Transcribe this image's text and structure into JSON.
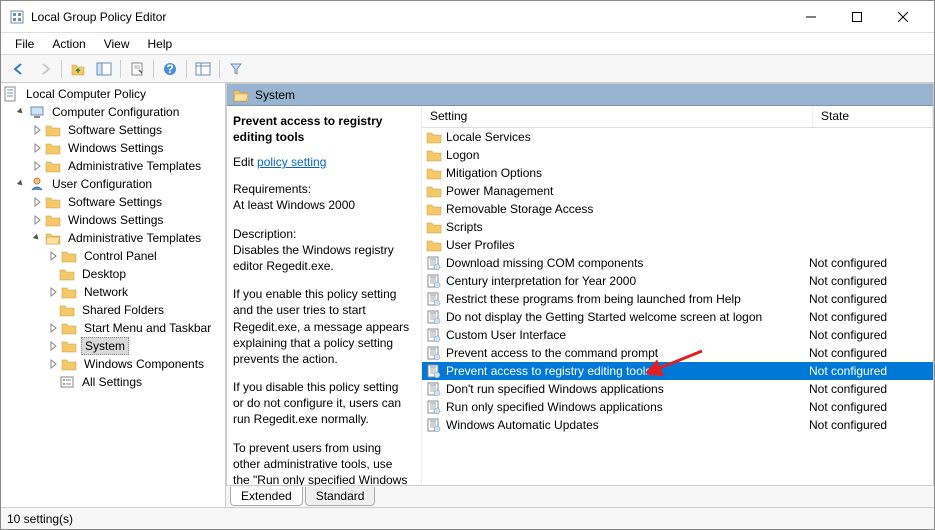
{
  "window": {
    "title": "Local Group Policy Editor"
  },
  "menus": [
    "File",
    "Action",
    "View",
    "Help"
  ],
  "tree": {
    "root": "Local Computer Policy",
    "comp_config": "Computer Configuration",
    "user_config": "User Configuration",
    "software": "Software Settings",
    "windows": "Windows Settings",
    "admin": "Administrative Templates",
    "control_panel": "Control Panel",
    "desktop": "Desktop",
    "network": "Network",
    "shared": "Shared Folders",
    "startmenu": "Start Menu and Taskbar",
    "system": "System",
    "wincomp": "Windows Components",
    "allsettings": "All Settings"
  },
  "path_header": "System",
  "details": {
    "title": "Prevent access to registry editing tools",
    "edit_prefix": "Edit ",
    "edit_link": "policy setting",
    "req_label": "Requirements:",
    "req_text": "At least Windows 2000",
    "desc_label": "Description:",
    "desc_1": "Disables the Windows registry editor Regedit.exe.",
    "desc_2": "If you enable this policy setting and the user tries to start Regedit.exe, a message appears explaining that a policy setting prevents the action.",
    "desc_3": "If you disable this policy setting or do not configure it, users can run Regedit.exe normally.",
    "desc_4": "To prevent users from using other administrative tools, use the \"Run only specified Windows"
  },
  "columns": {
    "setting": "Setting",
    "state": "State"
  },
  "settings": [
    {
      "type": "folder",
      "name": "Locale Services",
      "state": ""
    },
    {
      "type": "folder",
      "name": "Logon",
      "state": ""
    },
    {
      "type": "folder",
      "name": "Mitigation Options",
      "state": ""
    },
    {
      "type": "folder",
      "name": "Power Management",
      "state": ""
    },
    {
      "type": "folder",
      "name": "Removable Storage Access",
      "state": ""
    },
    {
      "type": "folder",
      "name": "Scripts",
      "state": ""
    },
    {
      "type": "folder",
      "name": "User Profiles",
      "state": ""
    },
    {
      "type": "policy",
      "name": "Download missing COM components",
      "state": "Not configured"
    },
    {
      "type": "policy",
      "name": "Century interpretation for Year 2000",
      "state": "Not configured"
    },
    {
      "type": "policy",
      "name": "Restrict these programs from being launched from Help",
      "state": "Not configured"
    },
    {
      "type": "policy",
      "name": "Do not display the Getting Started welcome screen at logon",
      "state": "Not configured"
    },
    {
      "type": "policy",
      "name": "Custom User Interface",
      "state": "Not configured"
    },
    {
      "type": "policy",
      "name": "Prevent access to the command prompt",
      "state": "Not configured"
    },
    {
      "type": "policy",
      "name": "Prevent access to registry editing tools",
      "state": "Not configured",
      "selected": true
    },
    {
      "type": "policy",
      "name": "Don't run specified Windows applications",
      "state": "Not configured"
    },
    {
      "type": "policy",
      "name": "Run only specified Windows applications",
      "state": "Not configured"
    },
    {
      "type": "policy",
      "name": "Windows Automatic Updates",
      "state": "Not configured"
    }
  ],
  "tabs": {
    "extended": "Extended",
    "standard": "Standard"
  },
  "status": "10 setting(s)"
}
